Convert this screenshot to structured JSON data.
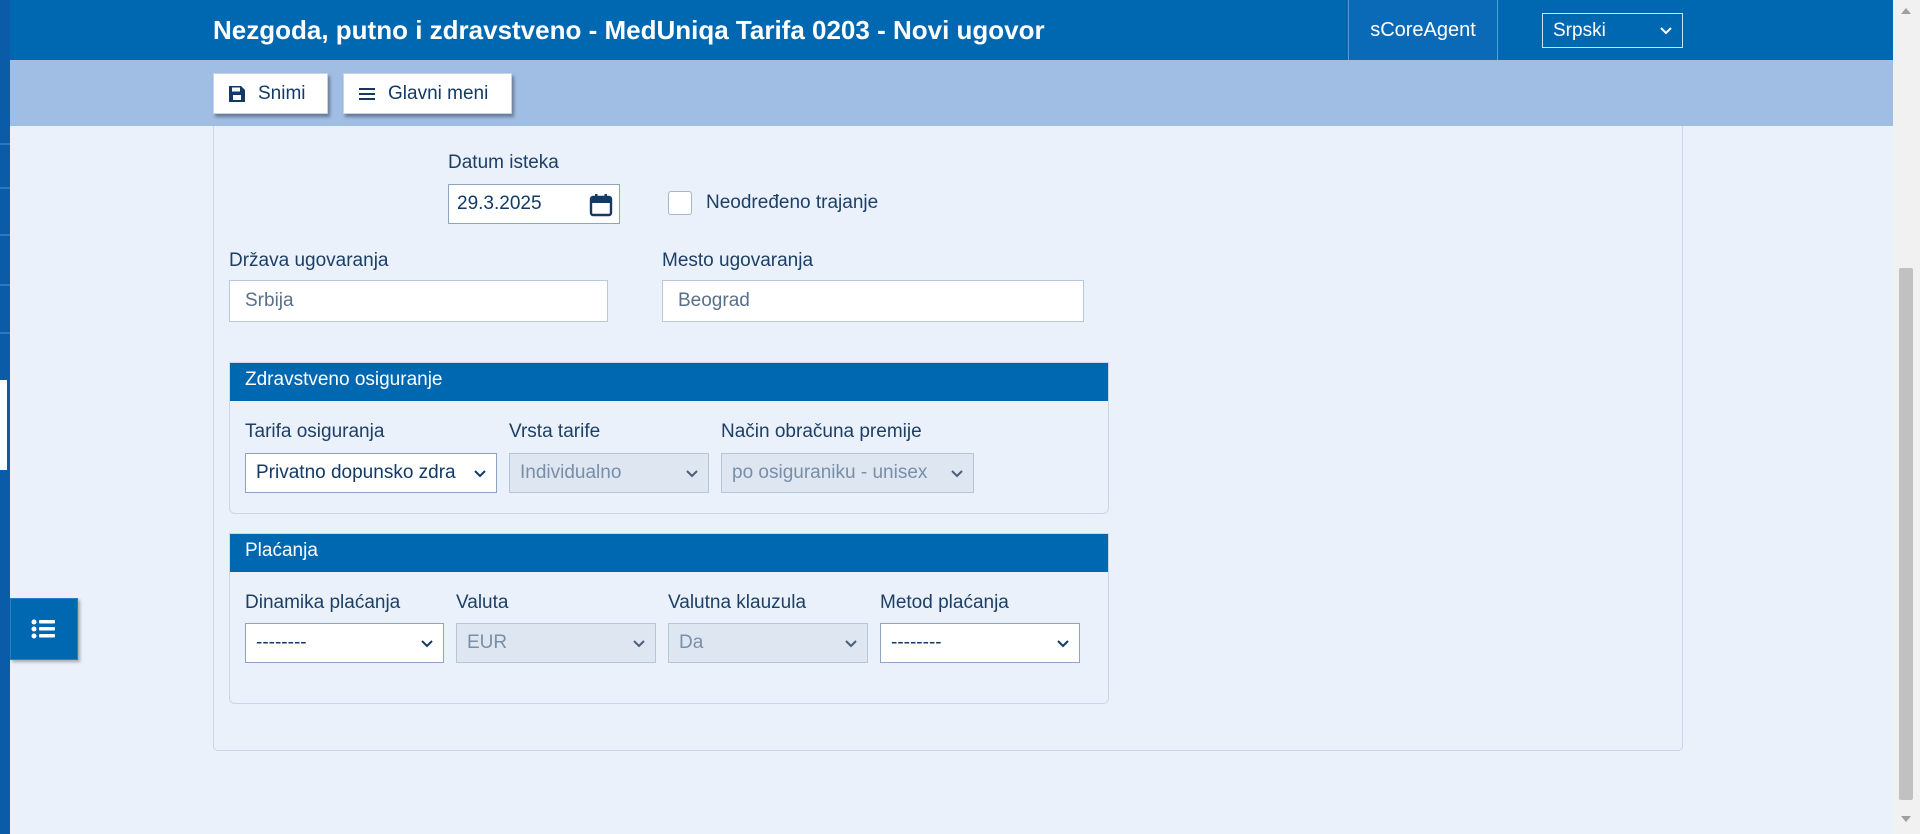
{
  "header": {
    "title": "Nezgoda, putno i zdravstveno - MedUniqa Tarifa 0203 - Novi ugovor",
    "agent": "sCoreAgent",
    "language": "Srpski"
  },
  "toolbar": {
    "save_label": "Snimi",
    "main_menu_label": "Glavni meni"
  },
  "form": {
    "expiry_date_label": "Datum isteka",
    "expiry_date_value": "29.3.2025",
    "indefinite_label": "Neodređeno trajanje",
    "country_label": "Država ugovaranja",
    "country_value": "Srbija",
    "city_label": "Mesto ugovaranja",
    "city_value": "Beograd"
  },
  "health": {
    "title": "Zdravstveno osiguranje",
    "tariff_label": "Tarifa osiguranja",
    "tariff_value": "Privatno dopunsko zdra",
    "tariff_type_label": "Vrsta tarife",
    "tariff_type_value": "Individualno",
    "premium_method_label": "Način obračuna premije",
    "premium_method_value": "po osiguraniku - unisex"
  },
  "payments": {
    "title": "Plaćanja",
    "dynamics_label": "Dinamika plaćanja",
    "dynamics_value": "--------",
    "currency_label": "Valuta",
    "currency_value": "EUR",
    "clause_label": "Valutna klauzula",
    "clause_value": "Da",
    "method_label": "Metod plaćanja",
    "method_value": "--------"
  },
  "colors": {
    "primary": "#0067b1",
    "toolbar": "#a0bde4",
    "background": "#eaf1fa"
  }
}
